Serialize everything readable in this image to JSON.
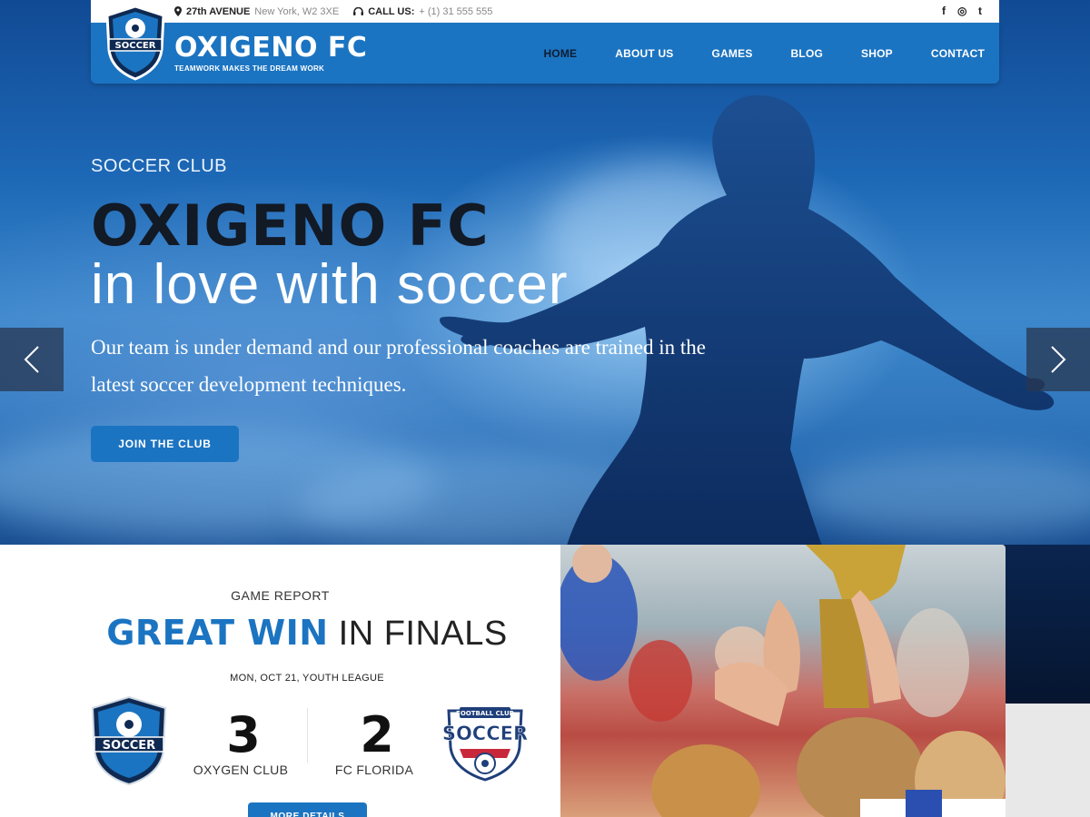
{
  "topbar": {
    "address_strong": "27th AVENUE",
    "address_rest": "New York, W2 3XE",
    "phone_label": "CALL US:",
    "phone_value": "+ (1) 31 555 555",
    "social": [
      "f",
      "◎",
      "t"
    ]
  },
  "brand": {
    "logo_text": "SOCCER",
    "name": "OXIGENO FC",
    "tagline": "TEAMWORK MAKES THE DREAM WORK"
  },
  "nav": {
    "items": [
      "HOME",
      "ABOUT US",
      "GAMES",
      "BLOG",
      "SHOP",
      "CONTACT"
    ],
    "active": "HOME"
  },
  "hero": {
    "kicker": "SOCCER CLUB",
    "headline": "OXIGENO FC",
    "subhead": "in love with soccer",
    "lead": "Our team is under demand and our professional coaches are trained in the latest soccer development techniques.",
    "cta": "JOIN THE CLUB"
  },
  "report": {
    "kicker": "GAME REPORT",
    "title_strong": "GREAT WIN",
    "title_light": "IN FINALS",
    "date": "MON, OCT 21, YOUTH LEAGUE",
    "home": {
      "score": "3",
      "name": "OXYGEN CLUB",
      "logo_text": "SOCCER"
    },
    "away": {
      "score": "2",
      "name": "FC FLORIDA",
      "logo_top": "FOOTBALL CLUB",
      "logo_text": "SOCCER"
    },
    "more": "MORE DETAILS"
  },
  "colors": {
    "accent": "#1b74c1",
    "dark": "#121a26"
  }
}
